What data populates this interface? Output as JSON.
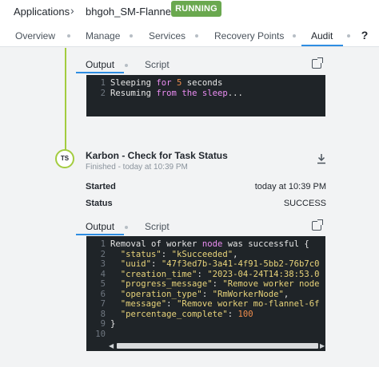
{
  "breadcrumb": {
    "root": "Applications",
    "app": "bhgoh_SM-Flannel"
  },
  "status_badge": {
    "label": "RUNNING",
    "color": "#6aa84f"
  },
  "tabs": [
    {
      "label": "Overview"
    },
    {
      "label": "Manage"
    },
    {
      "label": "Services"
    },
    {
      "label": "Recovery Points"
    },
    {
      "label": "Audit",
      "active": true
    }
  ],
  "accent_color": "#2e8de2",
  "panel1": {
    "tabs": [
      "Output",
      "Script"
    ],
    "active_tab": "Output",
    "lines": [
      "1",
      "2"
    ]
  },
  "task": {
    "initials": "TS",
    "title": "Karbon - Check for Task Status",
    "subtitle": "Finished - today at 10:39 PM",
    "started_label": "Started",
    "started_value": "today at 10:39 PM",
    "status_label": "Status",
    "status_value": "SUCCESS"
  },
  "panel2": {
    "tabs": [
      "Output",
      "Script"
    ],
    "active_tab": "Output",
    "lines": [
      "1",
      "2",
      "3",
      "4",
      "5",
      "6",
      "7",
      "8",
      "9",
      "10"
    ]
  },
  "icons": {
    "chevron": "chevron-right-icon",
    "help": "help-icon",
    "external": "external-link-icon",
    "download": "download-icon"
  }
}
